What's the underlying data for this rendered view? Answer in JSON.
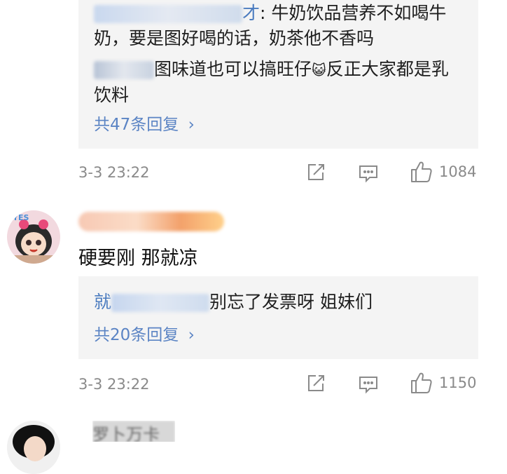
{
  "comment1": {
    "replies": [
      {
        "user": "才",
        "sep": ":",
        "text_line1": " 牛奶饮品营养不如喝牛",
        "text_line2": "奶，要是图好喝的话，奶茶他不香吗"
      },
      {
        "user": "",
        "text_line1": "图味道也可以搞旺仔",
        "emoji": "😺",
        "text_line1b": "反正大家都是乳",
        "text_line2": "饮料"
      }
    ],
    "more_replies": "共47条回复",
    "time": "3-3 23:22",
    "likes": "1084"
  },
  "comment2": {
    "text": "硬要刚 那就凉",
    "avatar_badge": "YES",
    "reply": {
      "user": "就",
      "text": "别忘了发票呀 姐妹们"
    },
    "more_replies": "共20条回复",
    "time": "3-3 23:22",
    "likes": "1150"
  },
  "comment3": {
    "user": "罗卜万卡"
  },
  "icons": {
    "chevron": "›",
    "share": "share-icon",
    "comment": "comment-icon",
    "like": "thumbs-up-icon"
  },
  "colors": {
    "link": "#5b84c4",
    "meta": "#8a8a8a",
    "reply_bg": "#f4f4f4"
  }
}
